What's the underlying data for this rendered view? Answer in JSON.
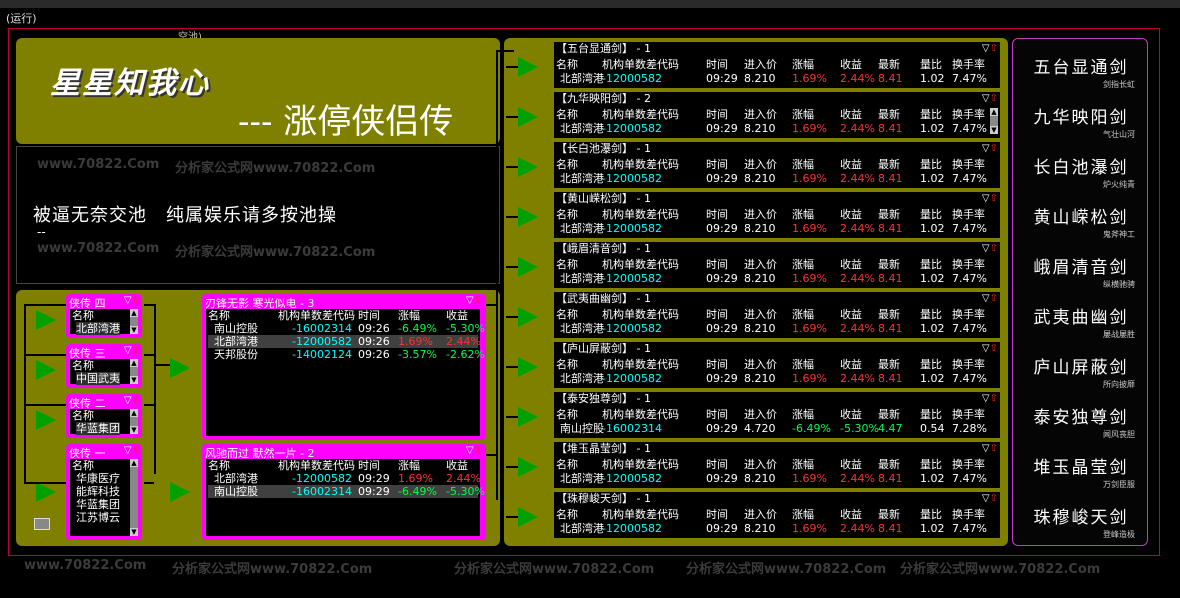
{
  "status": {
    "run_label": "(运行)",
    "frame_label": "空池)"
  },
  "title": {
    "line1": "星星知我心",
    "line2": "--- 涨停侠侣传"
  },
  "slogan": {
    "text": "被逼无奈交池　纯属娱乐请多按池操",
    "dash": "--"
  },
  "watermark": "分析家公式网www.70822.Com",
  "watermark_short": "www.70822.Com",
  "colors": {
    "olive": "#808000",
    "magenta": "#ff00ff",
    "red": "#ff3030",
    "green": "#00ff40",
    "cyan": "#00ffff",
    "frame": "#c0003c"
  },
  "headers_long": [
    "名称",
    "机构单数差代码",
    "时间",
    "进入价",
    "涨幅",
    "收益",
    "最新",
    "量比",
    "换手率"
  ],
  "headers_short": [
    "名称",
    "机构单数差代码",
    "时间",
    "涨幅",
    "收益"
  ],
  "mid_panels": [
    {
      "title": "【五台显通剑】 - 1",
      "rows": [
        [
          "北部湾港",
          "-12000582",
          "09:29",
          "8.210",
          "1.69%",
          "2.44%",
          "8.41",
          "1.02",
          "7.47%"
        ]
      ],
      "scroll": false
    },
    {
      "title": "【九华映阳剑】 - 2",
      "rows": [
        [
          "北部湾港",
          "-12000582",
          "09:29",
          "8.210",
          "1.69%",
          "2.44%",
          "8.41",
          "1.02",
          "7.47%"
        ]
      ],
      "scroll": true
    },
    {
      "title": "【长白池瀑剑】 - 1",
      "rows": [
        [
          "北部湾港",
          "-12000582",
          "09:29",
          "8.210",
          "1.69%",
          "2.44%",
          "8.41",
          "1.02",
          "7.47%"
        ]
      ],
      "scroll": false
    },
    {
      "title": "【黄山嵘松剑】 - 1",
      "rows": [
        [
          "北部湾港",
          "-12000582",
          "09:29",
          "8.210",
          "1.69%",
          "2.44%",
          "8.41",
          "1.02",
          "7.47%"
        ]
      ],
      "scroll": false
    },
    {
      "title": "【峨眉清音剑】 - 1",
      "rows": [
        [
          "北部湾港",
          "-12000582",
          "09:29",
          "8.210",
          "1.69%",
          "2.44%",
          "8.41",
          "1.02",
          "7.47%"
        ]
      ],
      "scroll": false
    },
    {
      "title": "【武夷曲幽剑】 - 1",
      "rows": [
        [
          "北部湾港",
          "-12000582",
          "09:29",
          "8.210",
          "1.69%",
          "2.44%",
          "8.41",
          "1.02",
          "7.47%"
        ]
      ],
      "scroll": false
    },
    {
      "title": "【庐山屏蔽剑】 - 1",
      "rows": [
        [
          "北部湾港",
          "-12000582",
          "09:29",
          "8.210",
          "1.69%",
          "2.44%",
          "8.41",
          "1.02",
          "7.47%"
        ]
      ],
      "scroll": false
    },
    {
      "title": "【泰安独尊剑】 - 1",
      "rows": [
        [
          "南山控股",
          "-16002314",
          "09:29",
          "4.720",
          "-6.49%",
          "-5.30%",
          "4.47",
          "0.54",
          "7.28%"
        ]
      ],
      "scroll": false
    },
    {
      "title": "【堆玉晶莹剑】 - 1",
      "rows": [
        [
          "北部湾港",
          "-12000582",
          "09:29",
          "8.210",
          "1.69%",
          "2.44%",
          "8.41",
          "1.02",
          "7.47%"
        ]
      ],
      "scroll": false
    },
    {
      "title": "【珠穆峻天剑】 - 1",
      "rows": [
        [
          "北部湾港",
          "-12000582",
          "09:29",
          "8.210",
          "1.69%",
          "2.44%",
          "8.41",
          "1.02",
          "7.47%"
        ]
      ],
      "scroll": false
    }
  ],
  "right_list": [
    {
      "name": "五台显通剑",
      "sub": "剑指长虹"
    },
    {
      "name": "九华映阳剑",
      "sub": "气壮山河"
    },
    {
      "name": "长白池瀑剑",
      "sub": "炉火纯青"
    },
    {
      "name": "黄山嵘松剑",
      "sub": "鬼斧神工"
    },
    {
      "name": "峨眉清音剑",
      "sub": "纵横驰骋"
    },
    {
      "name": "武夷曲幽剑",
      "sub": "屡战屡胜"
    },
    {
      "name": "庐山屏蔽剑",
      "sub": "所向披靡"
    },
    {
      "name": "泰安独尊剑",
      "sub": "闻风丧胆"
    },
    {
      "name": "堆玉晶莹剑",
      "sub": "万剑臣服"
    },
    {
      "name": "珠穆峻天剑",
      "sub": "登峰造极"
    }
  ],
  "xia_panels": [
    {
      "title": "侠传 四",
      "header": "名称",
      "items": [
        "北部湾港"
      ]
    },
    {
      "title": "侠传 三",
      "header": "名称",
      "items": [
        "中国武夷"
      ]
    },
    {
      "title": "侠传 二",
      "header": "名称",
      "items": [
        "华蓝集团"
      ]
    },
    {
      "title": "侠传 一",
      "header": "名称",
      "items": [
        "华康医疗",
        "能辉科技",
        "华蓝集团",
        "江苏博云"
      ]
    }
  ],
  "big_panels": [
    {
      "title": "刃锋无影 寒光似电 - 3",
      "rows": [
        [
          "南山控股",
          "-16002314",
          "09:26",
          "-6.49%",
          "-5.30%"
        ],
        [
          "北部湾港",
          "-12000582",
          "09:26",
          "1.69%",
          "2.44%"
        ],
        [
          "天邦股份",
          "-14002124",
          "09:26",
          "-3.57%",
          "-2.62%"
        ]
      ]
    },
    {
      "title": "风驰而过 默然一片 - 2",
      "rows": [
        [
          "北部湾港",
          "-12000582",
          "09:29",
          "1.69%",
          "2.44%"
        ],
        [
          "南山控股",
          "-16002314",
          "09:29",
          "-6.49%",
          "-5.30%"
        ]
      ]
    }
  ]
}
